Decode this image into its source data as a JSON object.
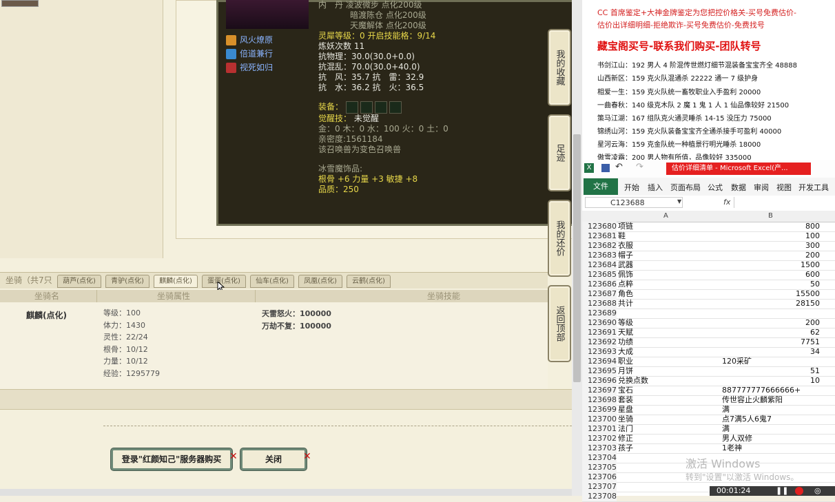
{
  "game": {
    "leftpanel_skills": [
      {
        "label": "风火燎原",
        "color": "#d8902a"
      },
      {
        "label": "倍道兼行",
        "color": "#3a8ad0"
      },
      {
        "label": "视死如归",
        "color": "#b83030"
      }
    ],
    "pet_details": {
      "top_lines": [
        "内　丹 凌波微步 点化200级",
        "暗渡陈仓 点化200级",
        "天魔解体 点化200级"
      ],
      "spirit_level": "灵犀等级：0 开启技能格：9/14",
      "refine_count": "炼妖次数 11",
      "resist_phys": "抗物理：30.0(30.0+0.0)",
      "resist_chaos": "抗混乱：70.0(30.0+40.0)",
      "resist_wind_thunder": "抗　风：35.7 抗　雷：32.9",
      "resist_water_fire": "抗　水：36.2 抗　火：36.5",
      "equip_label": "装备：",
      "awaken_label": "觉醒技：",
      "awaken_value": "未觉醒",
      "elements": "金：0 木：0 水：100 火：0 土：0",
      "intimacy": "亲密度:1561184",
      "transform_note": "该召唤兽为变色召唤兽",
      "ornament_title": "冰雪魔饰品:",
      "ornament_stats": "根骨 +6 力量 +3 敏捷 +8",
      "quality": "品质：250"
    },
    "side_buttons": [
      "我的收藏",
      "足迹",
      "我的还价",
      "返回顶部"
    ],
    "mount_header": "坐骑（共7只",
    "tabs": [
      "葫芦(点化)",
      "青驴(点化)",
      "麒麟(点化)",
      "蛋蛋(点化)",
      "仙车(点化)",
      "凤凰(点化)",
      "云鹤(点化)"
    ],
    "active_tab_index": 2,
    "columns": [
      "坐骑名",
      "坐骑属性",
      "坐骑技能"
    ],
    "mount": {
      "name": "麒麟(点化)",
      "attrs": [
        "等级：100",
        "体力：1430",
        "灵性：22/24",
        "根骨：10/12",
        "力量：10/12",
        "经验：1295779"
      ],
      "skills": [
        "天雷怒火：100000",
        "万劫不复：100000"
      ]
    },
    "buttons": {
      "buy": "登录\"红颜知己\"服务器购买",
      "close": "关闭"
    }
  },
  "doc": {
    "lines_top": [
      "CC 首席鉴定+大神金牌鉴定为您把控价格关-买号免费估价-",
      "估价出详细明细-拒绝欺诈-买号免费估价-免费找号"
    ],
    "headline": "藏宝阁买号-联系我们购买-团队转号",
    "entries": [
      "书剑江山：192 男人 4 阶混传世燃灯细节混装备宝宝齐全 48888",
      "山西新区：159 克火队混通杀 22222 通一 7 级护身",
      "相爱一生：159 克火队统一畜牧职业入手盈利 20000",
      "一曲春秋：140 级克木队 2 魔 1 鬼 1 人 1 仙品像较好 21500",
      "策马江湖：167 组队克火通灵睡杀 14-15 没压力 75000",
      "锦绣山河：159 克火队装备宝宝齐全通杀接手可盈利 40000",
      "星河云海：159 克金队统一种植景行明光睡杀 18000",
      "傲雪凌霜：200 男人物有所值，品像较好 335000"
    ]
  },
  "excel": {
    "title": "估价详细清单 - Microsoft Excel(产...",
    "ribbon_tabs": [
      "文件",
      "开始",
      "插入",
      "页面布局",
      "公式",
      "数据",
      "审阅",
      "视图",
      "开发工具"
    ],
    "name_box": "C123688",
    "fx": "fx",
    "col_a": "A",
    "col_b": "B",
    "rows": [
      {
        "n": "123680",
        "a": "项链",
        "b": "800",
        "num": true
      },
      {
        "n": "123681",
        "a": "鞋",
        "b": "100",
        "num": true
      },
      {
        "n": "123682",
        "a": "衣服",
        "b": "300",
        "num": true
      },
      {
        "n": "123683",
        "a": "帽子",
        "b": "200",
        "num": true
      },
      {
        "n": "123684",
        "a": "武器",
        "b": "1500",
        "num": true
      },
      {
        "n": "123685",
        "a": "佩饰",
        "b": "600",
        "num": true
      },
      {
        "n": "123686",
        "a": "点粹",
        "b": "50",
        "num": true
      },
      {
        "n": "123687",
        "a": "角色",
        "b": "15500",
        "num": true
      },
      {
        "n": "123688",
        "a": "共计",
        "b": "28150",
        "num": true
      },
      {
        "n": "123689",
        "a": "",
        "b": "",
        "num": true
      },
      {
        "n": "123690",
        "a": "等级",
        "b": "200",
        "num": true
      },
      {
        "n": "123691",
        "a": "天赋",
        "b": "62",
        "num": true
      },
      {
        "n": "123692",
        "a": "功绩",
        "b": "7751",
        "num": true
      },
      {
        "n": "123693",
        "a": "大成",
        "b": "34",
        "num": true
      },
      {
        "n": "123694",
        "a": "职业",
        "b": "120采矿",
        "num": false
      },
      {
        "n": "123695",
        "a": "月饼",
        "b": "51",
        "num": true
      },
      {
        "n": "123696",
        "a": "兑换点数",
        "b": "10",
        "num": true
      },
      {
        "n": "123697",
        "a": "宝石",
        "b": "887777777666666+",
        "num": false
      },
      {
        "n": "123698",
        "a": "套装",
        "b": "传世容止火麟紫阳",
        "num": false
      },
      {
        "n": "123699",
        "a": "星盘",
        "b": "满",
        "num": false
      },
      {
        "n": "123700",
        "a": "坐骑",
        "b": "点7满5人6鬼7",
        "num": false
      },
      {
        "n": "123701",
        "a": "法门",
        "b": "满",
        "num": false
      },
      {
        "n": "123702",
        "a": "修正",
        "b": "男人双修",
        "num": false
      },
      {
        "n": "123703",
        "a": "孩子",
        "b": "1老神",
        "num": false
      },
      {
        "n": "123704",
        "a": "",
        "b": "",
        "num": true
      },
      {
        "n": "123705",
        "a": "",
        "b": "",
        "num": true
      },
      {
        "n": "123706",
        "a": "",
        "b": "",
        "num": true
      },
      {
        "n": "123707",
        "a": "",
        "b": "",
        "num": true
      },
      {
        "n": "123708",
        "a": "",
        "b": "",
        "num": true
      }
    ]
  },
  "watermark": {
    "line1": "激活 Windows",
    "line2": "转到\"设置\"以激活 Windows。"
  },
  "recorder": {
    "time": "00:01:24"
  }
}
